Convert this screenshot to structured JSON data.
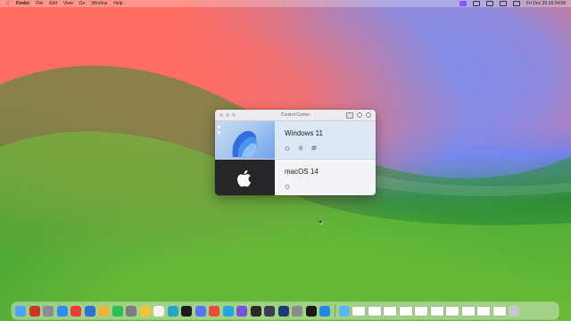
{
  "menubar": {
    "app_name": "Finder",
    "menus": [
      "File",
      "Edit",
      "View",
      "Go",
      "Window",
      "Help"
    ],
    "clock": "Fri Dec 29  18:34:58"
  },
  "window": {
    "title": "Control Center",
    "vms": [
      {
        "name": "Windows 11",
        "selected": true,
        "actions": [
          "power-icon",
          "settings-icon",
          "share-icon"
        ]
      },
      {
        "name": "macOS 14",
        "selected": false,
        "actions": [
          "power-icon"
        ]
      }
    ]
  },
  "dock": {
    "apps": [
      {
        "name": "finder-icon",
        "color": "#4aa3ff"
      },
      {
        "name": "parallels-icon",
        "color": "#c9362c"
      },
      {
        "name": "launchpad-icon",
        "color": "#8c8c96"
      },
      {
        "name": "safari-icon",
        "color": "#2c8df2"
      },
      {
        "name": "mail-icon",
        "color": "#e93d3d"
      },
      {
        "name": "keynote-icon",
        "color": "#2f6fd9"
      },
      {
        "name": "photos-icon",
        "color": "#f2b23a"
      },
      {
        "name": "facetime-icon",
        "color": "#2fbe55"
      },
      {
        "name": "settings-icon",
        "color": "#7b7b82"
      },
      {
        "name": "chrome-icon",
        "color": "#f0c33a"
      },
      {
        "name": "notes-icon",
        "color": "#f3f3f3"
      },
      {
        "name": "edge-icon",
        "color": "#26a7c8"
      },
      {
        "name": "chatgpt-icon",
        "color": "#1b1b1b"
      },
      {
        "name": "app-icon-blue",
        "color": "#5a72ff"
      },
      {
        "name": "app-icon-red",
        "color": "#e94b3c"
      },
      {
        "name": "telegram-icon",
        "color": "#2ba3e0"
      },
      {
        "name": "app-icon-purple",
        "color": "#7b4fe0"
      },
      {
        "name": "terminal-icon",
        "color": "#2a2a2a"
      },
      {
        "name": "app-icon-dark",
        "color": "#3a3f55"
      },
      {
        "name": "app-icon-navy",
        "color": "#1e3a78"
      },
      {
        "name": "app-icon-gray",
        "color": "#8c8c8c"
      },
      {
        "name": "obs-icon",
        "color": "#1a1a1a"
      },
      {
        "name": "windows-icon",
        "color": "#1f88e5"
      }
    ],
    "recent": [
      {
        "name": "folder-icon",
        "color": "#5bb5f5"
      },
      {
        "name": "trash-icon",
        "color": "#c8c8cc"
      }
    ]
  }
}
